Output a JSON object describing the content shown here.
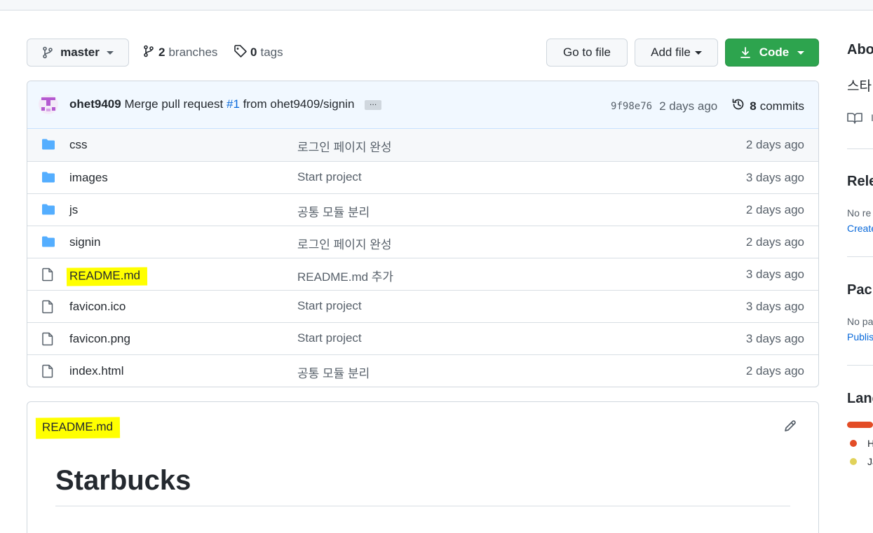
{
  "toolbar": {
    "branch": "master",
    "branches_count": "2",
    "branches_label": "branches",
    "tags_count": "0",
    "tags_label": "tags",
    "go_to_file": "Go to file",
    "add_file": "Add file",
    "code": "Code"
  },
  "commit": {
    "author": "ohet9409",
    "message_pre": "Merge pull request",
    "pr": "#1",
    "message_post": "from ohet9409/signin",
    "ellipsis": "…",
    "sha": "9f98e76",
    "time": "2 days ago",
    "commits_count": "8",
    "commits_label": "commits"
  },
  "files": [
    {
      "type": "dir",
      "name": "css",
      "message": "로그인 페이지 완성",
      "age": "2 days ago"
    },
    {
      "type": "dir",
      "name": "images",
      "message": "Start project",
      "age": "3 days ago"
    },
    {
      "type": "dir",
      "name": "js",
      "message": "공통 모듈 분리",
      "age": "2 days ago"
    },
    {
      "type": "dir",
      "name": "signin",
      "message": "로그인 페이지 완성",
      "age": "2 days ago"
    },
    {
      "type": "file",
      "name": "README.md",
      "message": "README.md 추가",
      "age": "3 days ago"
    },
    {
      "type": "file",
      "name": "favicon.ico",
      "message": "Start project",
      "age": "3 days ago"
    },
    {
      "type": "file",
      "name": "favicon.png",
      "message": "Start project",
      "age": "3 days ago"
    },
    {
      "type": "file",
      "name": "index.html",
      "message": "공통 모듈 분리",
      "age": "2 days ago"
    }
  ],
  "readme": {
    "filename": "README.md",
    "heading": "Starbucks"
  },
  "sidebar": {
    "about": "Abo",
    "about_desc": "스타",
    "readme_short": "I",
    "releases": "Rele",
    "releases_text": "No re",
    "releases_link": "Create",
    "packages": "Pack",
    "packages_text": "No pa",
    "packages_link": "Publis",
    "languages": "Lang",
    "lang1": "H",
    "lang2": "Ja"
  },
  "colors": {
    "accent_green": "#2da44e",
    "highlight": "#ffff00",
    "folder": "#54aeff",
    "link": "#0969da",
    "lang_html": "#e34c26",
    "lang_js": "#f1e05a"
  }
}
